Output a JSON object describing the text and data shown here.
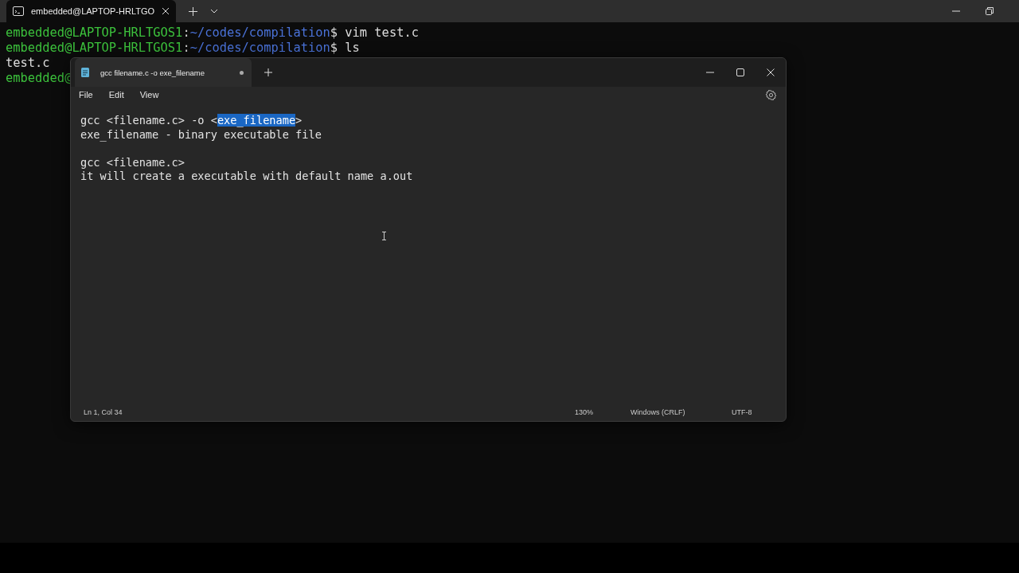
{
  "terminal": {
    "tab": {
      "title": "embedded@LAPTOP-HRLTGO",
      "selected": true
    },
    "lines": [
      {
        "kind": "prompt",
        "user": "embedded@LAPTOP-HRLTGOS1",
        "sep": ":",
        "path": "~/codes/compilation",
        "dollar": "$",
        "command": " vim test.c"
      },
      {
        "kind": "prompt",
        "user": "embedded@LAPTOP-HRLTGOS1",
        "sep": ":",
        "path": "~/codes/compilation",
        "dollar": "$",
        "command": " ls"
      },
      {
        "kind": "output",
        "text": "test.c"
      },
      {
        "kind": "prompt",
        "user": "embedded@"
      }
    ]
  },
  "notepad": {
    "tab": {
      "title": "gcc filename.c -o exe_filename",
      "unsaved": true,
      "selected": true
    },
    "menu": [
      "File",
      "Edit",
      "View"
    ],
    "paragraphs": [
      [
        [
          {
            "text": "gcc <filename.c> -o <",
            "selected": false
          },
          {
            "text": "exe_filename",
            "selected": true
          },
          {
            "text": ">",
            "selected": false
          }
        ],
        [
          {
            "text": "exe_filename - binary executable file",
            "selected": false
          }
        ]
      ],
      [
        [
          {
            "text": "gcc <filename.c>",
            "selected": false
          }
        ],
        [
          {
            "text": "it will create a executable with default name a.out",
            "selected": false
          }
        ]
      ]
    ],
    "status_bar": {
      "position": "Ln 1, Col 34",
      "zoom": "130%",
      "line_ending": "Windows (CRLF)",
      "encoding": "UTF-8"
    }
  }
}
